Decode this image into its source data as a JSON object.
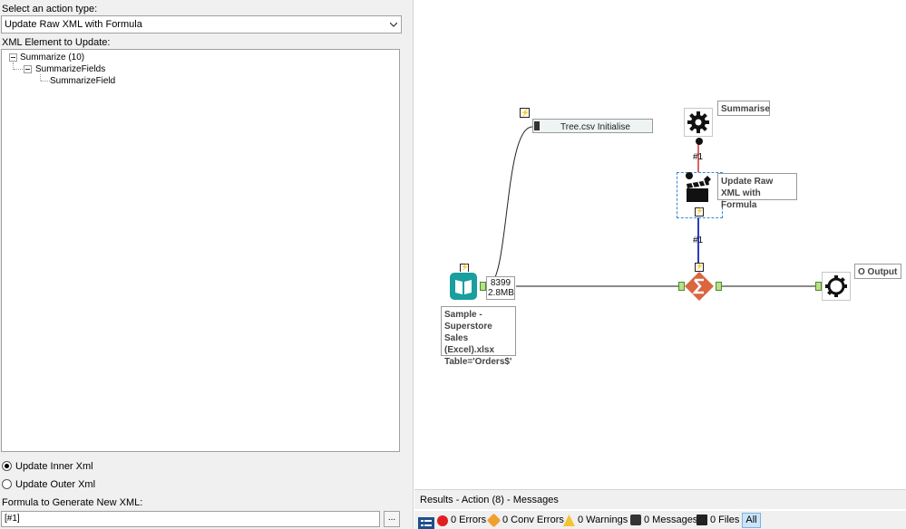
{
  "config": {
    "action_type_label": "Select an action type:",
    "action_type_value": "Update Raw XML with Formula",
    "xml_element_label": "XML Element to Update:",
    "tree": {
      "root": "Summarize (10)",
      "child": "SummarizeFields",
      "leaf": "SummarizeField"
    },
    "radio_inner": "Update Inner Xml",
    "radio_outer": "Update Outer Xml",
    "radio_selected": "Update Inner Xml",
    "formula_label": "Formula to Generate New XML:",
    "formula_value": "[#1]",
    "ellipsis": "..."
  },
  "canvas": {
    "tree_csv_label": "Tree.csv Initialise",
    "summarise_label": "Summarise",
    "update_raw_xml_label": "Update Raw XML with Formula",
    "connection_1": "#1",
    "connection_2": "#1",
    "record_count": "8399",
    "data_size": "2.8MB",
    "input_annotation": "Sample - Superstore Sales (Excel).xlsx Table='Orders$'",
    "output_label": "O Output"
  },
  "results": {
    "header": "Results - Action (8) - Messages",
    "errors": "0 Errors",
    "conv_errors": "0 Conv Errors",
    "warnings": "0 Warnings",
    "messages": "0 Messages",
    "files": "0 Files",
    "all": "All"
  },
  "colors": {
    "input_teal": "#1a9e9e",
    "summarize_orange": "#d9663f",
    "connection_blue": "#2b3dbf",
    "connection_red": "#cc3333",
    "error_red": "#e02020",
    "warning_orange": "#f0a030",
    "selected_tool_border": "#3a86d0"
  },
  "icons": {
    "dropdown": "chevron-down-icon",
    "input_tool": "book-icon",
    "summarize_tool": "sigma-icon",
    "macro_tool": "gear-icon",
    "update_xml_tool": "clapperboard-icon",
    "output_tool": "gear-output-icon",
    "control_anchor": "lightning-icon"
  }
}
